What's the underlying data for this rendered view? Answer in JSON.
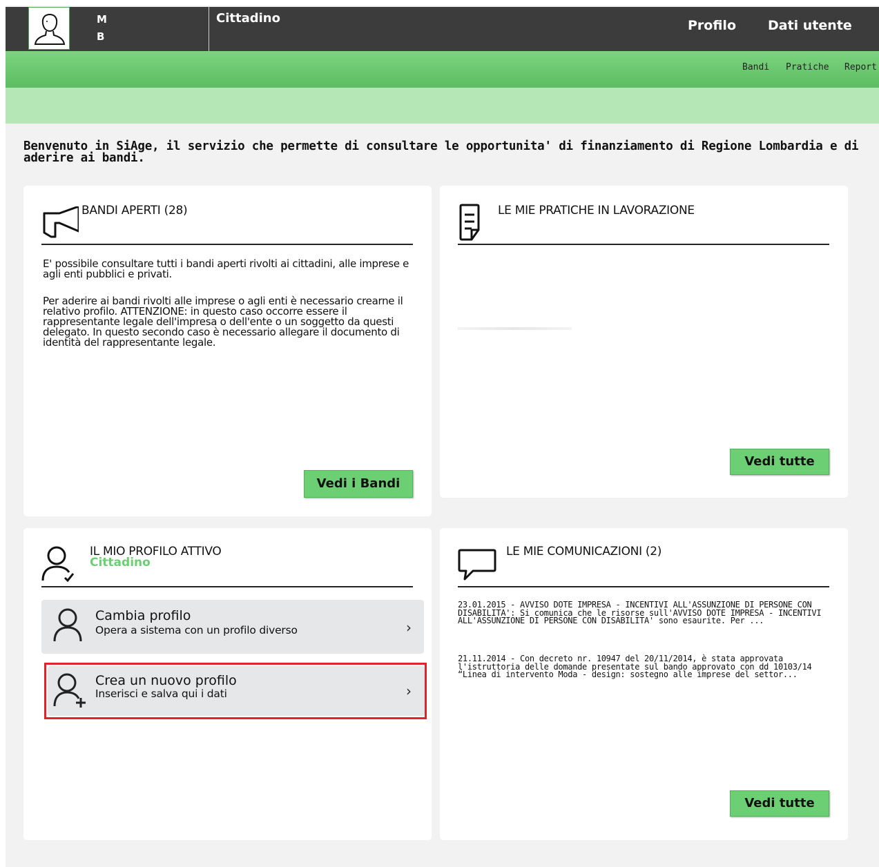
{
  "header": {
    "initial_1": "M",
    "initial_2": "B",
    "role": "Cittadino",
    "nav_profilo": "Profilo",
    "nav_dati_utente": "Dati utente"
  },
  "subnav": {
    "bandi": "Bandi",
    "pratiche": "Pratiche",
    "report": "Report"
  },
  "welcome": "Benvenuto in SiAge, il servizio che permette di consultare le opportunita' di finanziamento di Regione Lombardia e di aderire ai bandi.",
  "bandi_card": {
    "title": "BANDI APERTI (28)",
    "para1": "E' possibile consultare tutti i bandi aperti rivolti ai cittadini, alle imprese e agli enti pubblici e privati.",
    "para2": "Per aderire ai bandi rivolti alle imprese o agli enti è necessario crearne il relativo profilo. ATTENZIONE: in questo caso occorre essere il rappresentante legale dell'impresa o dell'ente o un soggetto da questi delegato. In questo secondo caso è necessario allegare il documento di identità del rappresentante legale.",
    "button": "Vedi i Bandi"
  },
  "pratiche_card": {
    "title": "LE MIE PRATICHE IN LAVORAZIONE",
    "button": "Vedi tutte"
  },
  "profilo_card": {
    "title": "IL MIO PROFILO ATTIVO",
    "active_role": "Cittadino",
    "options": [
      {
        "title": "Cambia profilo",
        "subtitle": "Opera a sistema con un profilo diverso"
      },
      {
        "title": "Crea un nuovo profilo",
        "subtitle": "Inserisci e salva qui i dati"
      }
    ]
  },
  "comunicazioni_card": {
    "title": "LE MIE COMUNICAZIONI (2)",
    "messages": [
      "23.01.2015 - AVVISO DOTE IMPRESA - INCENTIVI ALL'ASSUNZIONE DI PERSONE CON DISABILITA': Si comunica che le risorse sull'AVVISO DOTE IMPRESA - INCENTIVI ALL'ASSUNZIONE DI PERSONE CON DISABILITA' sono esaurite. Per ...",
      "21.11.2014 - Con decreto nr. 10947 del 20/11/2014, è stata approvata l'istruttoria delle domande presentate sul bando approvato con dd 10103/14 “Linea di intervento Moda - design: sostegno alle imprese del settor..."
    ],
    "button": "Vedi tutte"
  },
  "icons": {
    "avatar": "user-avatar-icon",
    "megaphone": "megaphone-icon",
    "document": "document-icon",
    "user_check": "user-check-icon",
    "chat": "chat-bubble-icon",
    "user": "user-icon",
    "user_add": "user-add-icon",
    "chevron": "chevron-right-icon"
  },
  "colors": {
    "header_bg": "#3c3c3c",
    "green_bar": "#5cbd62",
    "light_green_bar": "#b4e6b6",
    "button_green": "#6ccf73",
    "highlight_red": "#e0242c"
  }
}
